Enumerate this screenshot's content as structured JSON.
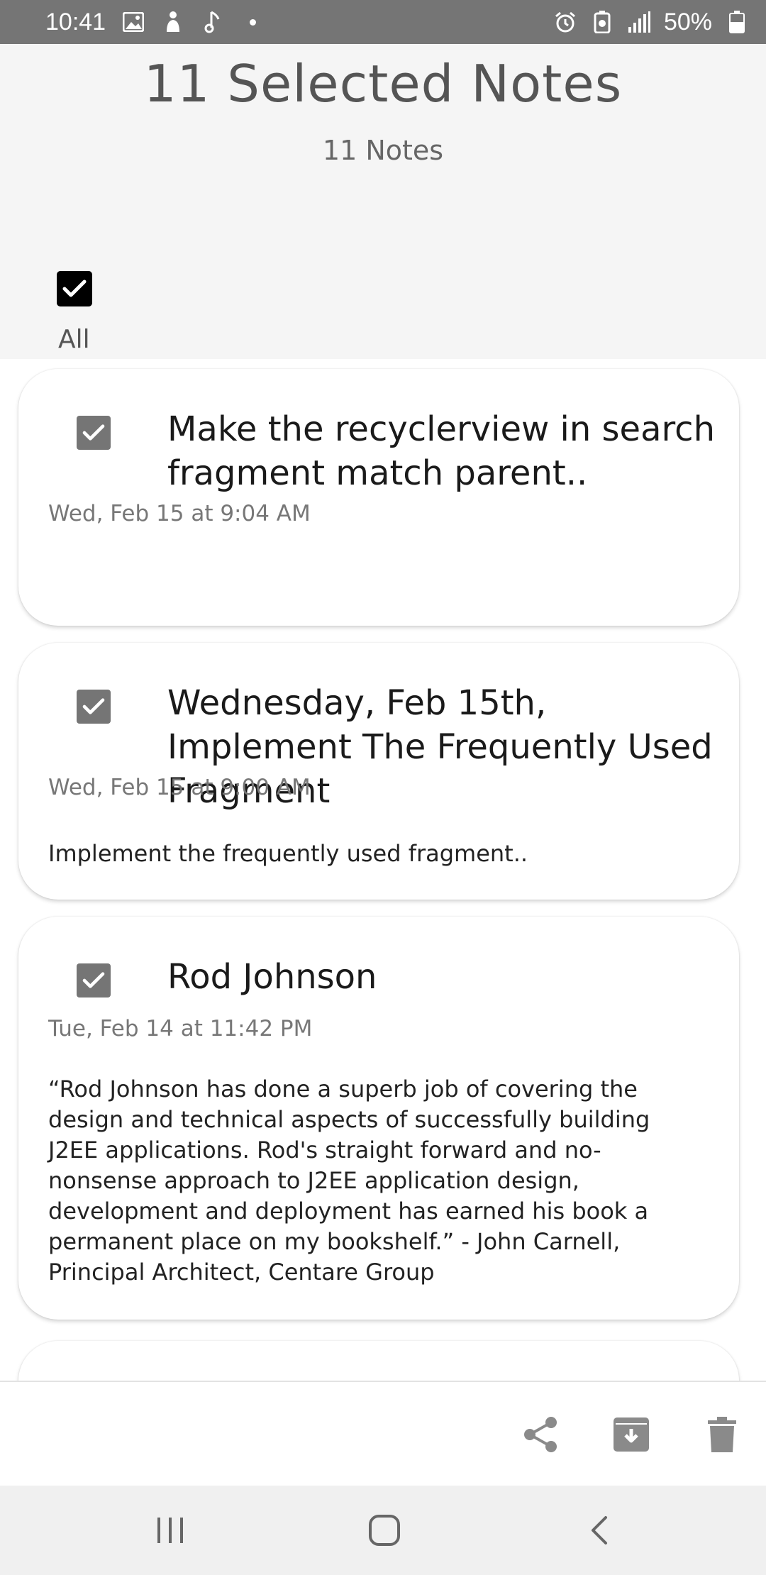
{
  "status_bar": {
    "time": "10:41",
    "battery": "50%",
    "left_icons": [
      "image-icon",
      "app-icon",
      "music-note-icon",
      "dot-icon"
    ],
    "right_icons": [
      "alarm-icon",
      "battery-saver-icon",
      "signal-icon",
      "battery-icon"
    ]
  },
  "header": {
    "title": "11 Selected Notes",
    "subtitle": "11 Notes",
    "select_all_label": "All",
    "select_all_checked": true
  },
  "notes": [
    {
      "title": "Make the recyclerview in search fragment match parent..",
      "date": "Wed, Feb 15 at 9:04 AM",
      "body": "",
      "checked": true
    },
    {
      "title": "Wednesday, Feb 15th, Implement The Frequently Used Fragment",
      "date": "Wed, Feb 15 at 9:00 AM",
      "body": "Implement the frequently used fragment..",
      "checked": true
    },
    {
      "title": "Rod Johnson",
      "date": "Tue, Feb 14 at 11:42 PM",
      "body": "“Rod Johnson has done a superb job of covering the design and technical aspects of successfully building J2EE applications. Rod's straight forward and no-nonsense approach to J2EE application design, development and deployment has earned his book a permanent place on my bookshelf.” - John Carnell, Principal Architect, Centare Group",
      "checked": true
    }
  ],
  "toolbar": {
    "actions": [
      "share-icon",
      "archive-icon",
      "delete-icon"
    ]
  },
  "navbar": {
    "buttons": [
      "recent-apps-icon",
      "home-icon",
      "back-icon"
    ]
  },
  "colors": {
    "status_bar": "#757575",
    "check_selected": "#757575",
    "select_all": "#000000",
    "icon_gray": "#888888"
  }
}
